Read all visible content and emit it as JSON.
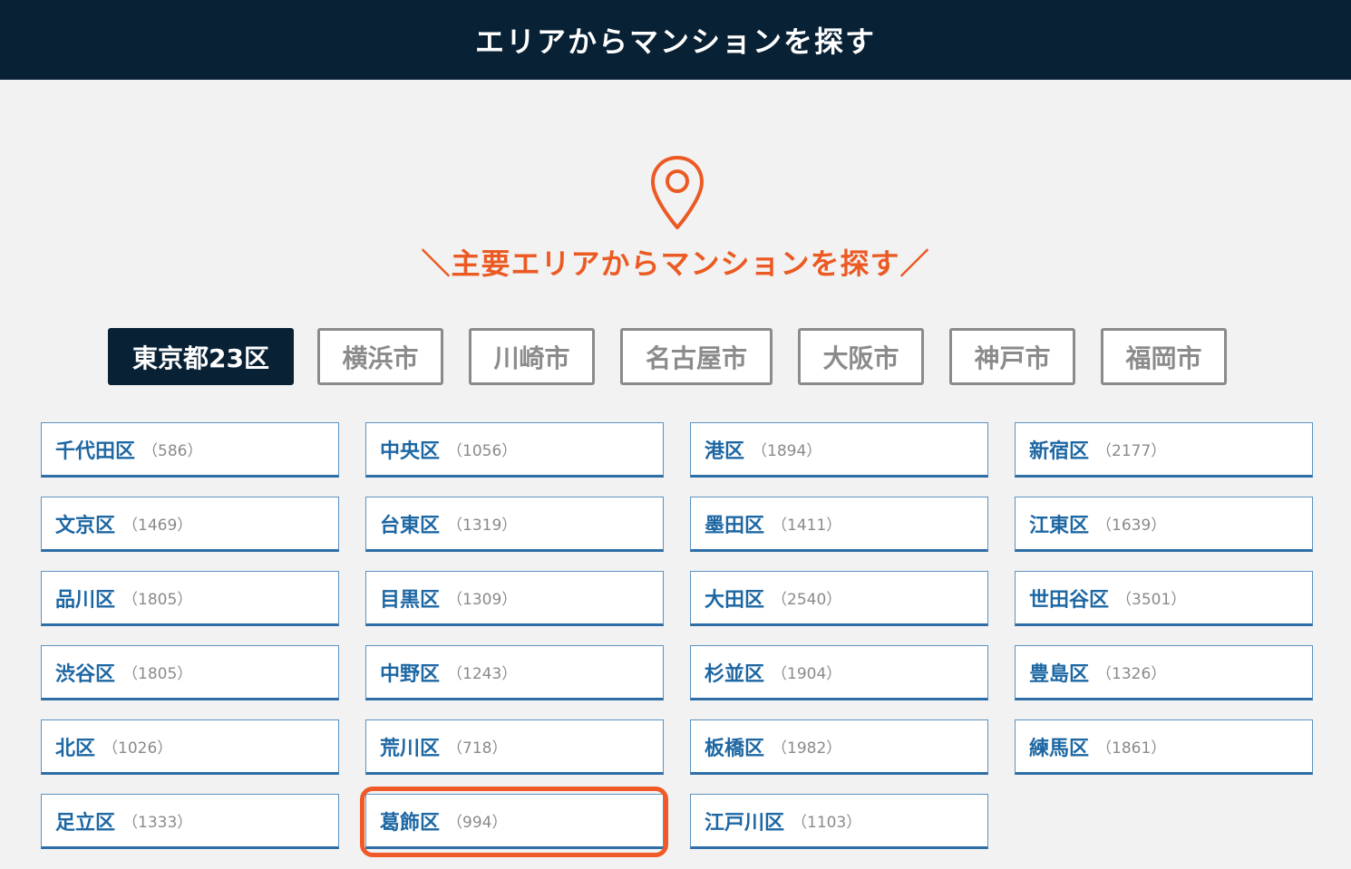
{
  "header": {
    "title": "エリアからマンションを探す"
  },
  "icons": {
    "pin": "location-pin-icon",
    "pin_color": "#ec5a24"
  },
  "section": {
    "subtitle": "＼主要エリアからマンションを探す／"
  },
  "colors": {
    "header_bg": "#082135",
    "accent": "#ec5a24",
    "link": "#1d67a3",
    "count": "#8a8a8a",
    "tab_border": "#8b8b8b"
  },
  "cities": [
    {
      "label": "東京都23区",
      "active": true
    },
    {
      "label": "横浜市",
      "active": false
    },
    {
      "label": "川崎市",
      "active": false
    },
    {
      "label": "名古屋市",
      "active": false
    },
    {
      "label": "大阪市",
      "active": false
    },
    {
      "label": "神戸市",
      "active": false
    },
    {
      "label": "福岡市",
      "active": false
    }
  ],
  "wards": [
    {
      "name": "千代田区",
      "count": "（586）"
    },
    {
      "name": "中央区",
      "count": "（1056）"
    },
    {
      "name": "港区",
      "count": "（1894）"
    },
    {
      "name": "新宿区",
      "count": "（2177）"
    },
    {
      "name": "文京区",
      "count": "（1469）"
    },
    {
      "name": "台東区",
      "count": "（1319）"
    },
    {
      "name": "墨田区",
      "count": "（1411）"
    },
    {
      "name": "江東区",
      "count": "（1639）"
    },
    {
      "name": "品川区",
      "count": "（1805）"
    },
    {
      "name": "目黒区",
      "count": "（1309）"
    },
    {
      "name": "大田区",
      "count": "（2540）"
    },
    {
      "name": "世田谷区",
      "count": "（3501）"
    },
    {
      "name": "渋谷区",
      "count": "（1805）"
    },
    {
      "name": "中野区",
      "count": "（1243）"
    },
    {
      "name": "杉並区",
      "count": "（1904）"
    },
    {
      "name": "豊島区",
      "count": "（1326）"
    },
    {
      "name": "北区",
      "count": "（1026）"
    },
    {
      "name": "荒川区",
      "count": "（718）"
    },
    {
      "name": "板橋区",
      "count": "（1982）"
    },
    {
      "name": "練馬区",
      "count": "（1861）"
    },
    {
      "name": "足立区",
      "count": "（1333）"
    },
    {
      "name": "葛飾区",
      "count": "（994）",
      "highlighted": true
    },
    {
      "name": "江戸川区",
      "count": "（1103）"
    }
  ]
}
